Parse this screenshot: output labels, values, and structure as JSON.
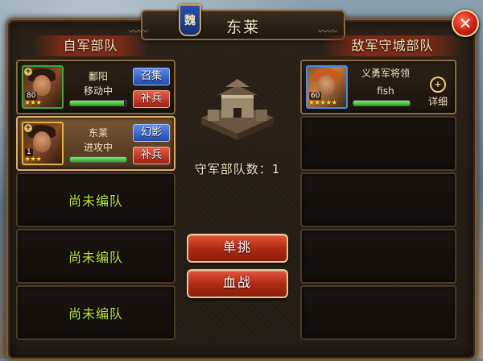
{
  "title": "东莱",
  "kingdom_badge": "魏",
  "close_glyph": "✕",
  "left_header": "自军部队",
  "right_header": "敌军守城部队",
  "defender_count_label": "守军部队数：1",
  "actions": {
    "duel": "单挑",
    "battle": "血战"
  },
  "friendly_units": [
    {
      "name": "鄱阳",
      "status": "移动中",
      "level": "80",
      "stars": "★★★",
      "btn_top": "召集",
      "btn_bottom": "补兵",
      "hp_fraction": 0.95
    },
    {
      "name": "东莱",
      "status": "进攻中",
      "level": "1",
      "stars": "★★★",
      "btn_top": "幻影",
      "btn_bottom": "补兵",
      "hp_fraction": 1.0
    }
  ],
  "unassigned_label": "尚未编队",
  "enemy_units": [
    {
      "name": "义勇军将领",
      "player": "fish",
      "level": "60",
      "stars": "★★★★★",
      "detail_label": "详细",
      "hp_fraction": 1.0
    }
  ],
  "colors": {
    "frame_border": "#7a5a35",
    "header_bg": "#7a2a16",
    "unassigned_text": "#b6e63a",
    "hp_fill": "#2ea622",
    "btn_blue": "#234aa8",
    "btn_red": "#9a2212"
  }
}
